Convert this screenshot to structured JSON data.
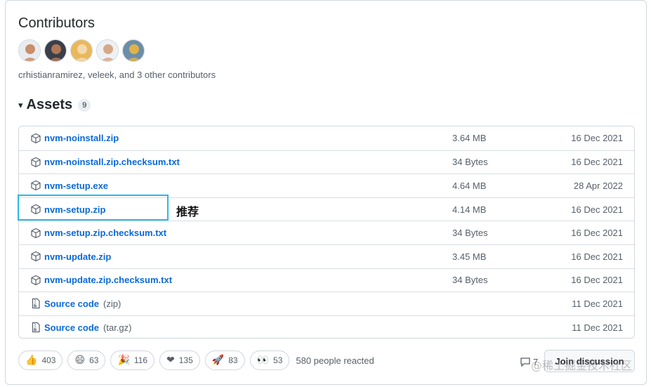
{
  "contributors": {
    "title": "Contributors",
    "avatars": [
      {
        "name": "avatar-1",
        "bg": "#e8ecef",
        "fg": "#c98e6a"
      },
      {
        "name": "avatar-2",
        "bg": "#3a3f4a",
        "fg": "#b07755"
      },
      {
        "name": "avatar-3",
        "bg": "#e9b85a",
        "fg": "#f2d9b0"
      },
      {
        "name": "avatar-4",
        "bg": "#eef1f4",
        "fg": "#d7a888"
      },
      {
        "name": "avatar-5",
        "bg": "#6b8ea8",
        "fg": "#e0b24a"
      }
    ],
    "text": "crhistianramirez, veleek, and 3 other contributors"
  },
  "assets": {
    "title": "Assets",
    "count": "9",
    "rows": [
      {
        "name": "nvm-noinstall.zip",
        "sub": "",
        "icon": "package-icon",
        "size": "3.64 MB",
        "date": "16 Dec 2021"
      },
      {
        "name": "nvm-noinstall.zip.checksum.txt",
        "sub": "",
        "icon": "package-icon",
        "size": "34 Bytes",
        "date": "16 Dec 2021"
      },
      {
        "name": "nvm-setup.exe",
        "sub": "",
        "icon": "package-icon",
        "size": "4.64 MB",
        "date": "28 Apr 2022"
      },
      {
        "name": "nvm-setup.zip",
        "sub": "",
        "icon": "package-icon",
        "size": "4.14 MB",
        "date": "16 Dec 2021"
      },
      {
        "name": "nvm-setup.zip.checksum.txt",
        "sub": "",
        "icon": "package-icon",
        "size": "34 Bytes",
        "date": "16 Dec 2021"
      },
      {
        "name": "nvm-update.zip",
        "sub": "",
        "icon": "package-icon",
        "size": "3.45 MB",
        "date": "16 Dec 2021"
      },
      {
        "name": "nvm-update.zip.checksum.txt",
        "sub": "",
        "icon": "package-icon",
        "size": "34 Bytes",
        "date": "16 Dec 2021"
      },
      {
        "name": "Source code",
        "sub": "(zip)",
        "icon": "file-zip-icon",
        "size": "",
        "date": "11 Dec 2021"
      },
      {
        "name": "Source code",
        "sub": "(tar.gz)",
        "icon": "file-zip-icon",
        "size": "",
        "date": "11 Dec 2021"
      }
    ]
  },
  "annotation": "推荐",
  "reactions": {
    "items": [
      {
        "emoji": "👍",
        "icon": "thumbs-up-icon",
        "count": "403"
      },
      {
        "emoji": "😄",
        "icon": "laugh-icon",
        "count": "63"
      },
      {
        "emoji": "🎉",
        "icon": "hooray-icon",
        "count": "116"
      },
      {
        "emoji": "❤",
        "icon": "heart-icon",
        "count": "135"
      },
      {
        "emoji": "🚀",
        "icon": "rocket-icon",
        "count": "83"
      },
      {
        "emoji": "👀",
        "icon": "eyes-icon",
        "count": "53"
      }
    ],
    "summary": "580 people reacted"
  },
  "discussion": {
    "comment_count": "7",
    "join_label": "Join discussion"
  },
  "watermark": "@稀土掘金技术社区",
  "colors": {
    "link": "#0969da",
    "highlight": "#2cb8e8",
    "muted": "#57606a"
  }
}
